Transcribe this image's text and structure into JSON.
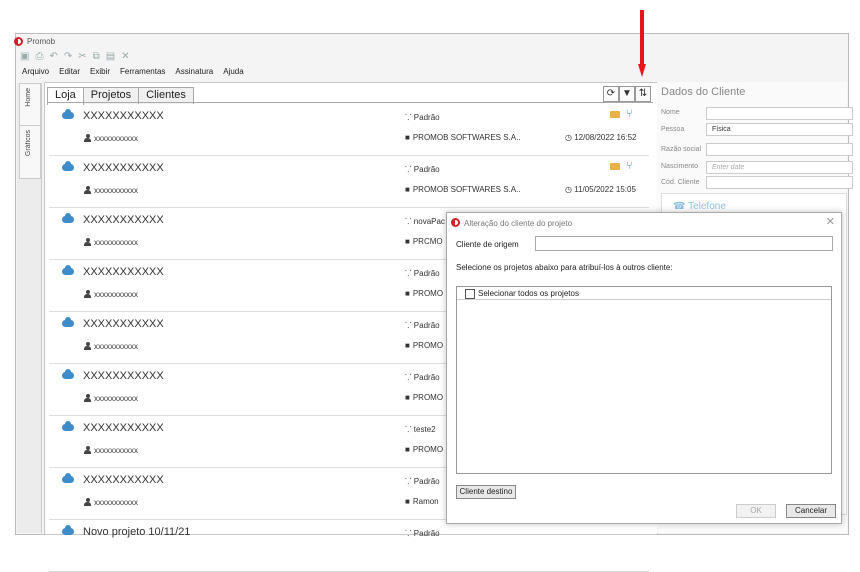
{
  "app": {
    "title": "Promob"
  },
  "toolbar": {
    "icons": [
      "save-icon",
      "print-icon",
      "undo-icon",
      "redo-icon",
      "cut-icon",
      "copy-icon",
      "paste-icon",
      "delete-icon"
    ]
  },
  "menu": [
    "Arquivo",
    "Editar",
    "Exibir",
    "Ferramentas",
    "Assinatura",
    "Ajuda"
  ],
  "side_tabs": [
    "Home",
    "Gráficos"
  ],
  "tabs": [
    "Loja",
    "Projetos",
    "Clientes"
  ],
  "projects": [
    {
      "name": "XXXXXXXXXXX",
      "client": "xxxxxxxxxxx",
      "branch": "Padrão",
      "company": "PROMOB SOFTWARES S.A..",
      "date": "12/08/2022 16:52"
    },
    {
      "name": "XXXXXXXXXXX",
      "client": "xxxxxxxxxxx",
      "branch": "Padrão",
      "company": "PROMOB SOFTWARES S.A..",
      "date": "11/05/2022 15:05"
    },
    {
      "name": "XXXXXXXXXXX",
      "client": "xxxxxxxxxxx",
      "branch": "novaPac",
      "company": "PRCMO",
      "date": ""
    },
    {
      "name": "XXXXXXXXXXX",
      "client": "xxxxxxxxxxx",
      "branch": "Padrão",
      "company": "PROMO",
      "date": ""
    },
    {
      "name": "XXXXXXXXXXX",
      "client": "xxxxxxxxxxx",
      "branch": "Padrão",
      "company": "PROMO",
      "date": ""
    },
    {
      "name": "XXXXXXXXXXX",
      "client": "xxxxxxxxxxx",
      "branch": "Padrão",
      "company": "PROMO",
      "date": ""
    },
    {
      "name": "XXXXXXXXXXX",
      "client": "xxxxxxxxxxx",
      "branch": "teste2",
      "company": "PROMO",
      "date": ""
    },
    {
      "name": "XXXXXXXXXXX",
      "client": "xxxxxxxxxxx",
      "branch": "Padrão",
      "company": "Ramon",
      "date": ""
    },
    {
      "name": "Novo projeto 10/11/21",
      "client": "",
      "branch": "Padrão",
      "company": "",
      "date": ""
    }
  ],
  "client_panel": {
    "title": "Dados do Cliente",
    "nome_label": "Nome",
    "pessoa_label": "Pessoa",
    "pessoa_value": "Física",
    "razao_label": "Razão social",
    "nascimento_label": "Nascimento",
    "nascimento_placeholder": "Enter date",
    "cod_label": "Cód. Cliente",
    "telefone_label": "Telefone"
  },
  "dialog": {
    "title": "Alteração do cliente do projeto",
    "origem_label": "Cliente de origem",
    "instruction": "Selecione os projetos abaixo para atribuí-los à outros cliente:",
    "select_all": "Selecionar todos os projetos",
    "destino_button": "Cliente destino",
    "ok_button": "OK",
    "cancel_button": "Cancelar"
  },
  "colors": {
    "arrow": "#e8141b",
    "accent": "#3d8bc9",
    "logo": "#d0202a"
  }
}
